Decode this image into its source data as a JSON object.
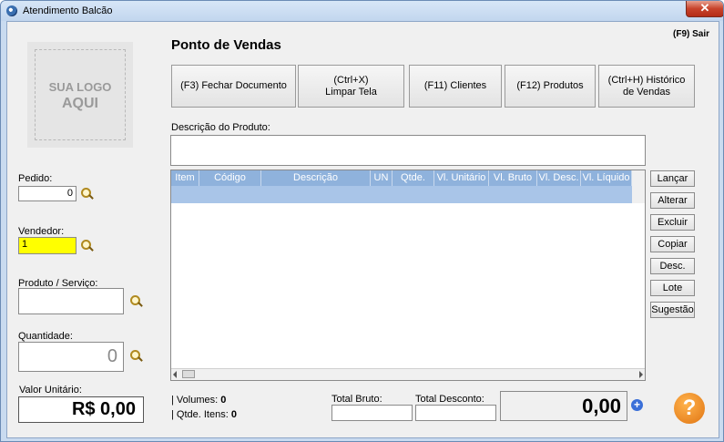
{
  "window": {
    "title": "Atendimento Balcão",
    "close_label": "✕"
  },
  "logo": {
    "line1": "SUA LOGO",
    "line2": "AQUI"
  },
  "left": {
    "pedido_label": "Pedido:",
    "pedido_value": "0",
    "vendedor_label": "Vendedor:",
    "vendedor_value": "1",
    "produto_label": "Produto / Serviço:",
    "produto_value": "",
    "quantidade_label": "Quantidade:",
    "quantidade_value": "0",
    "valor_label": "Valor Unitário:",
    "valor_value": "R$ 0,00"
  },
  "header": {
    "title": "Ponto de Vendas",
    "exit_label": "(F9) Sair"
  },
  "toolbar": [
    {
      "label": "(F3) Fechar Documento"
    },
    {
      "label": "(Ctrl+X)\nLimpar Tela"
    },
    {
      "label": "(F11) Clientes"
    },
    {
      "label": "(F12) Produtos"
    },
    {
      "label": "(Ctrl+H) Histórico\nde Vendas"
    }
  ],
  "descricao": {
    "label": "Descrição do Produto:",
    "value": ""
  },
  "grid": {
    "columns": [
      "Item",
      "Código",
      "Descrição",
      "UN",
      "Qtde.",
      "Vl. Unitário",
      "Vl. Bruto",
      "Vl. Desc.",
      "Vl. Líquido"
    ]
  },
  "side_buttons": [
    "Lançar",
    "Alterar",
    "Excluir",
    "Copiar",
    "Desc.",
    "Lote",
    "Sugestão"
  ],
  "footer": {
    "volumes_label": "| Volumes:",
    "volumes_value": "0",
    "itens_label": "| Qtde. Itens:",
    "itens_value": "0",
    "total_bruto_label": "Total Bruto:",
    "total_bruto_value": "",
    "total_desconto_label": "Total Desconto:",
    "total_desconto_value": "",
    "total_value": "0,00",
    "plus_icon": "+",
    "help_icon": "?"
  },
  "colors": {
    "accent": "#8fb2dc",
    "highlight": "#ffff00",
    "help": "#e07412"
  }
}
